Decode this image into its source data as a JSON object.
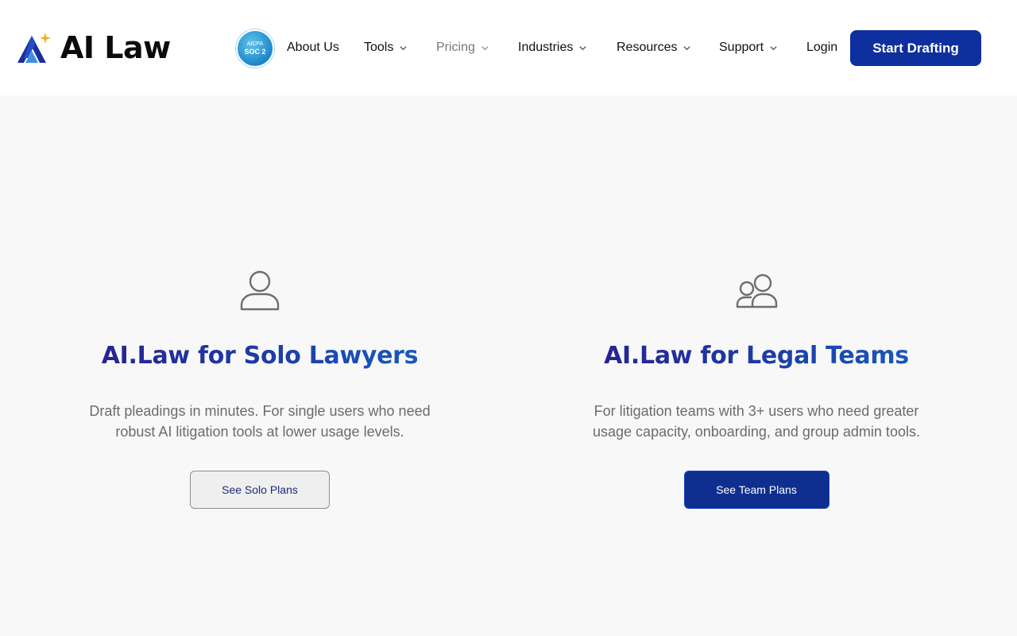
{
  "brand": {
    "name": "AI Law"
  },
  "badge": {
    "line1": "AICPA",
    "line2": "SOC 2"
  },
  "nav": {
    "about": "About Us",
    "tools": "Tools",
    "pricing": "Pricing",
    "industries": "Industries",
    "resources": "Resources",
    "support": "Support",
    "login": "Login"
  },
  "cta": {
    "label": "Start Drafting"
  },
  "cards": {
    "solo": {
      "title": "AI.Law for Solo Lawyers",
      "description": "Draft pleadings in minutes.  For single users who need robust AI litigation tools at lower usage levels.",
      "button": "See Solo Plans",
      "icon": "user-icon"
    },
    "team": {
      "title": "AI.Law for Legal Teams",
      "description": "For litigation teams with 3+ users who need greater usage capacity, onboarding, and group admin tools.",
      "button": "See Team Plans",
      "icon": "users-icon"
    }
  },
  "colors": {
    "brand_blue": "#0e2f9e",
    "title_gradient_start": "#2a1a8a",
    "title_gradient_end": "#1766c6",
    "page_background": "#f8f8f8",
    "muted_text": "#6b6b6b"
  }
}
